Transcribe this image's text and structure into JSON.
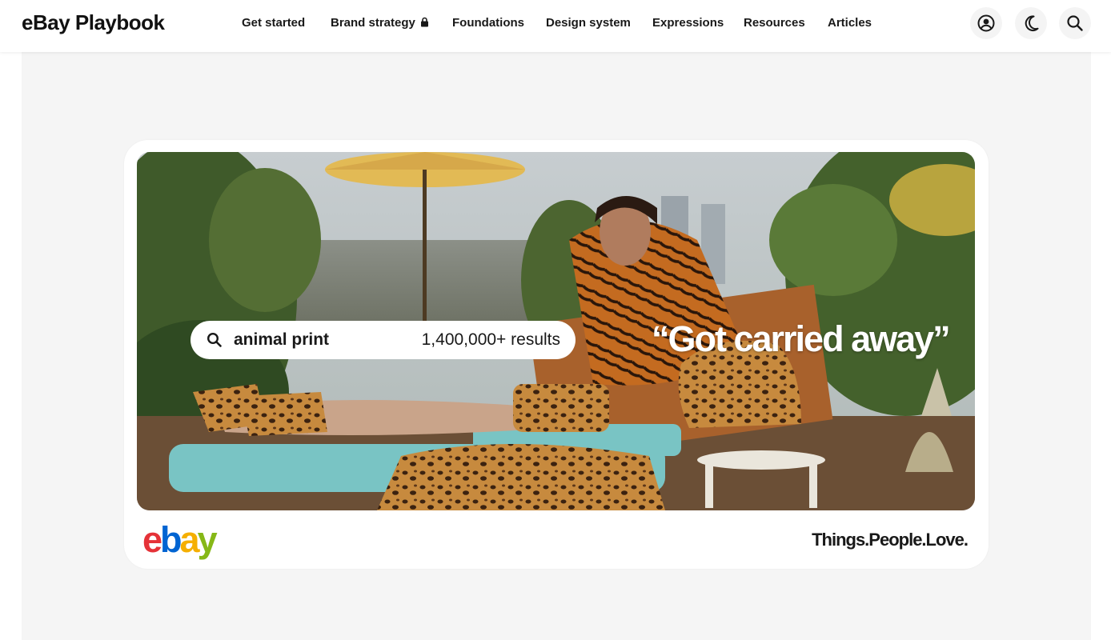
{
  "header": {
    "brand": "eBay Playbook",
    "nav": [
      {
        "label": "Get started"
      },
      {
        "label": "Brand strategy",
        "locked": true
      },
      {
        "label": "Foundations"
      },
      {
        "label": "Design system"
      },
      {
        "label": "Expressions"
      },
      {
        "label": "Resources"
      },
      {
        "label": "Articles"
      }
    ],
    "icons": [
      "account-icon",
      "dark-mode-icon",
      "search-icon"
    ]
  },
  "ad": {
    "search_query": "animal print",
    "results": "1,400,000+ results",
    "quote": "“Got carried away”",
    "logo_letters": [
      "e",
      "b",
      "a",
      "y"
    ],
    "logo_colors": [
      "#e53238",
      "#0064d2",
      "#f5af02",
      "#86b817"
    ],
    "tagline": "Things.People.Love."
  }
}
